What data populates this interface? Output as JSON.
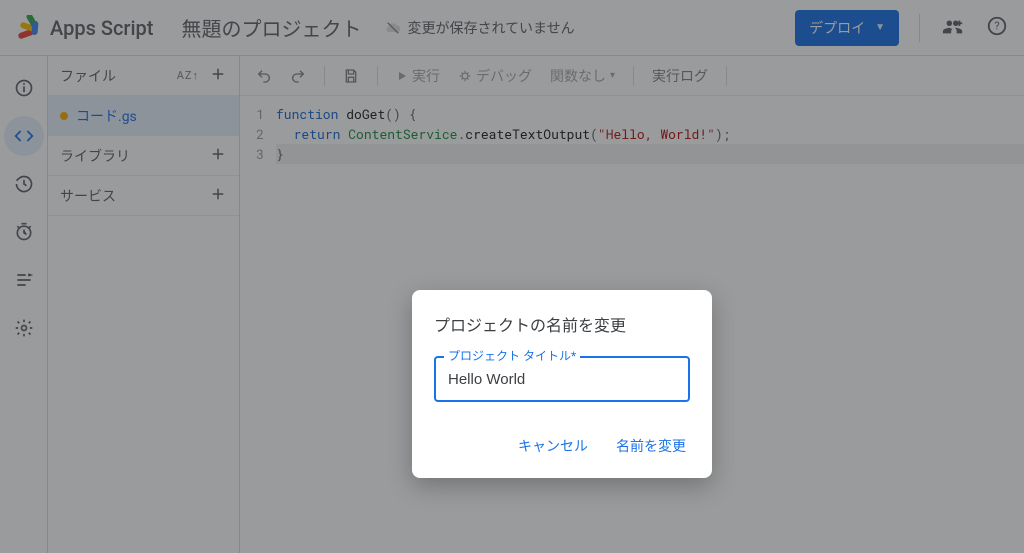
{
  "header": {
    "product_name": "Apps Script",
    "project_title": "無題のプロジェクト",
    "save_status": "変更が保存されていません",
    "deploy_label": "デプロイ"
  },
  "leftrail": {
    "items": [
      "overview",
      "editor",
      "triggers",
      "executions",
      "logs",
      "settings"
    ]
  },
  "files": {
    "header_label": "ファイル",
    "sort_label": "AZ",
    "rows": [
      {
        "label": "コード.gs",
        "type": "file",
        "selected": true,
        "unsaved": true
      },
      {
        "label": "ライブラリ",
        "type": "section"
      },
      {
        "label": "サービス",
        "type": "section"
      }
    ]
  },
  "toolbar": {
    "run_label": "実行",
    "debug_label": "デバッグ",
    "func_label": "関数なし",
    "log_label": "実行ログ"
  },
  "code": {
    "lines": [
      {
        "n": 1,
        "kind": "sig"
      },
      {
        "n": 2,
        "kind": "ret"
      },
      {
        "n": 3,
        "kind": "close"
      }
    ],
    "tokens": {
      "function_kw": "function",
      "fn_name": "doGet",
      "return_kw": "return",
      "class_name": "ContentService",
      "method_name": "createTextOutput",
      "string_lit": "\"Hello, World!\""
    }
  },
  "dialog": {
    "title": "プロジェクトの名前を変更",
    "field_label": "プロジェクト タイトル*",
    "field_value": "Hello World",
    "cancel_label": "キャンセル",
    "confirm_label": "名前を変更"
  }
}
